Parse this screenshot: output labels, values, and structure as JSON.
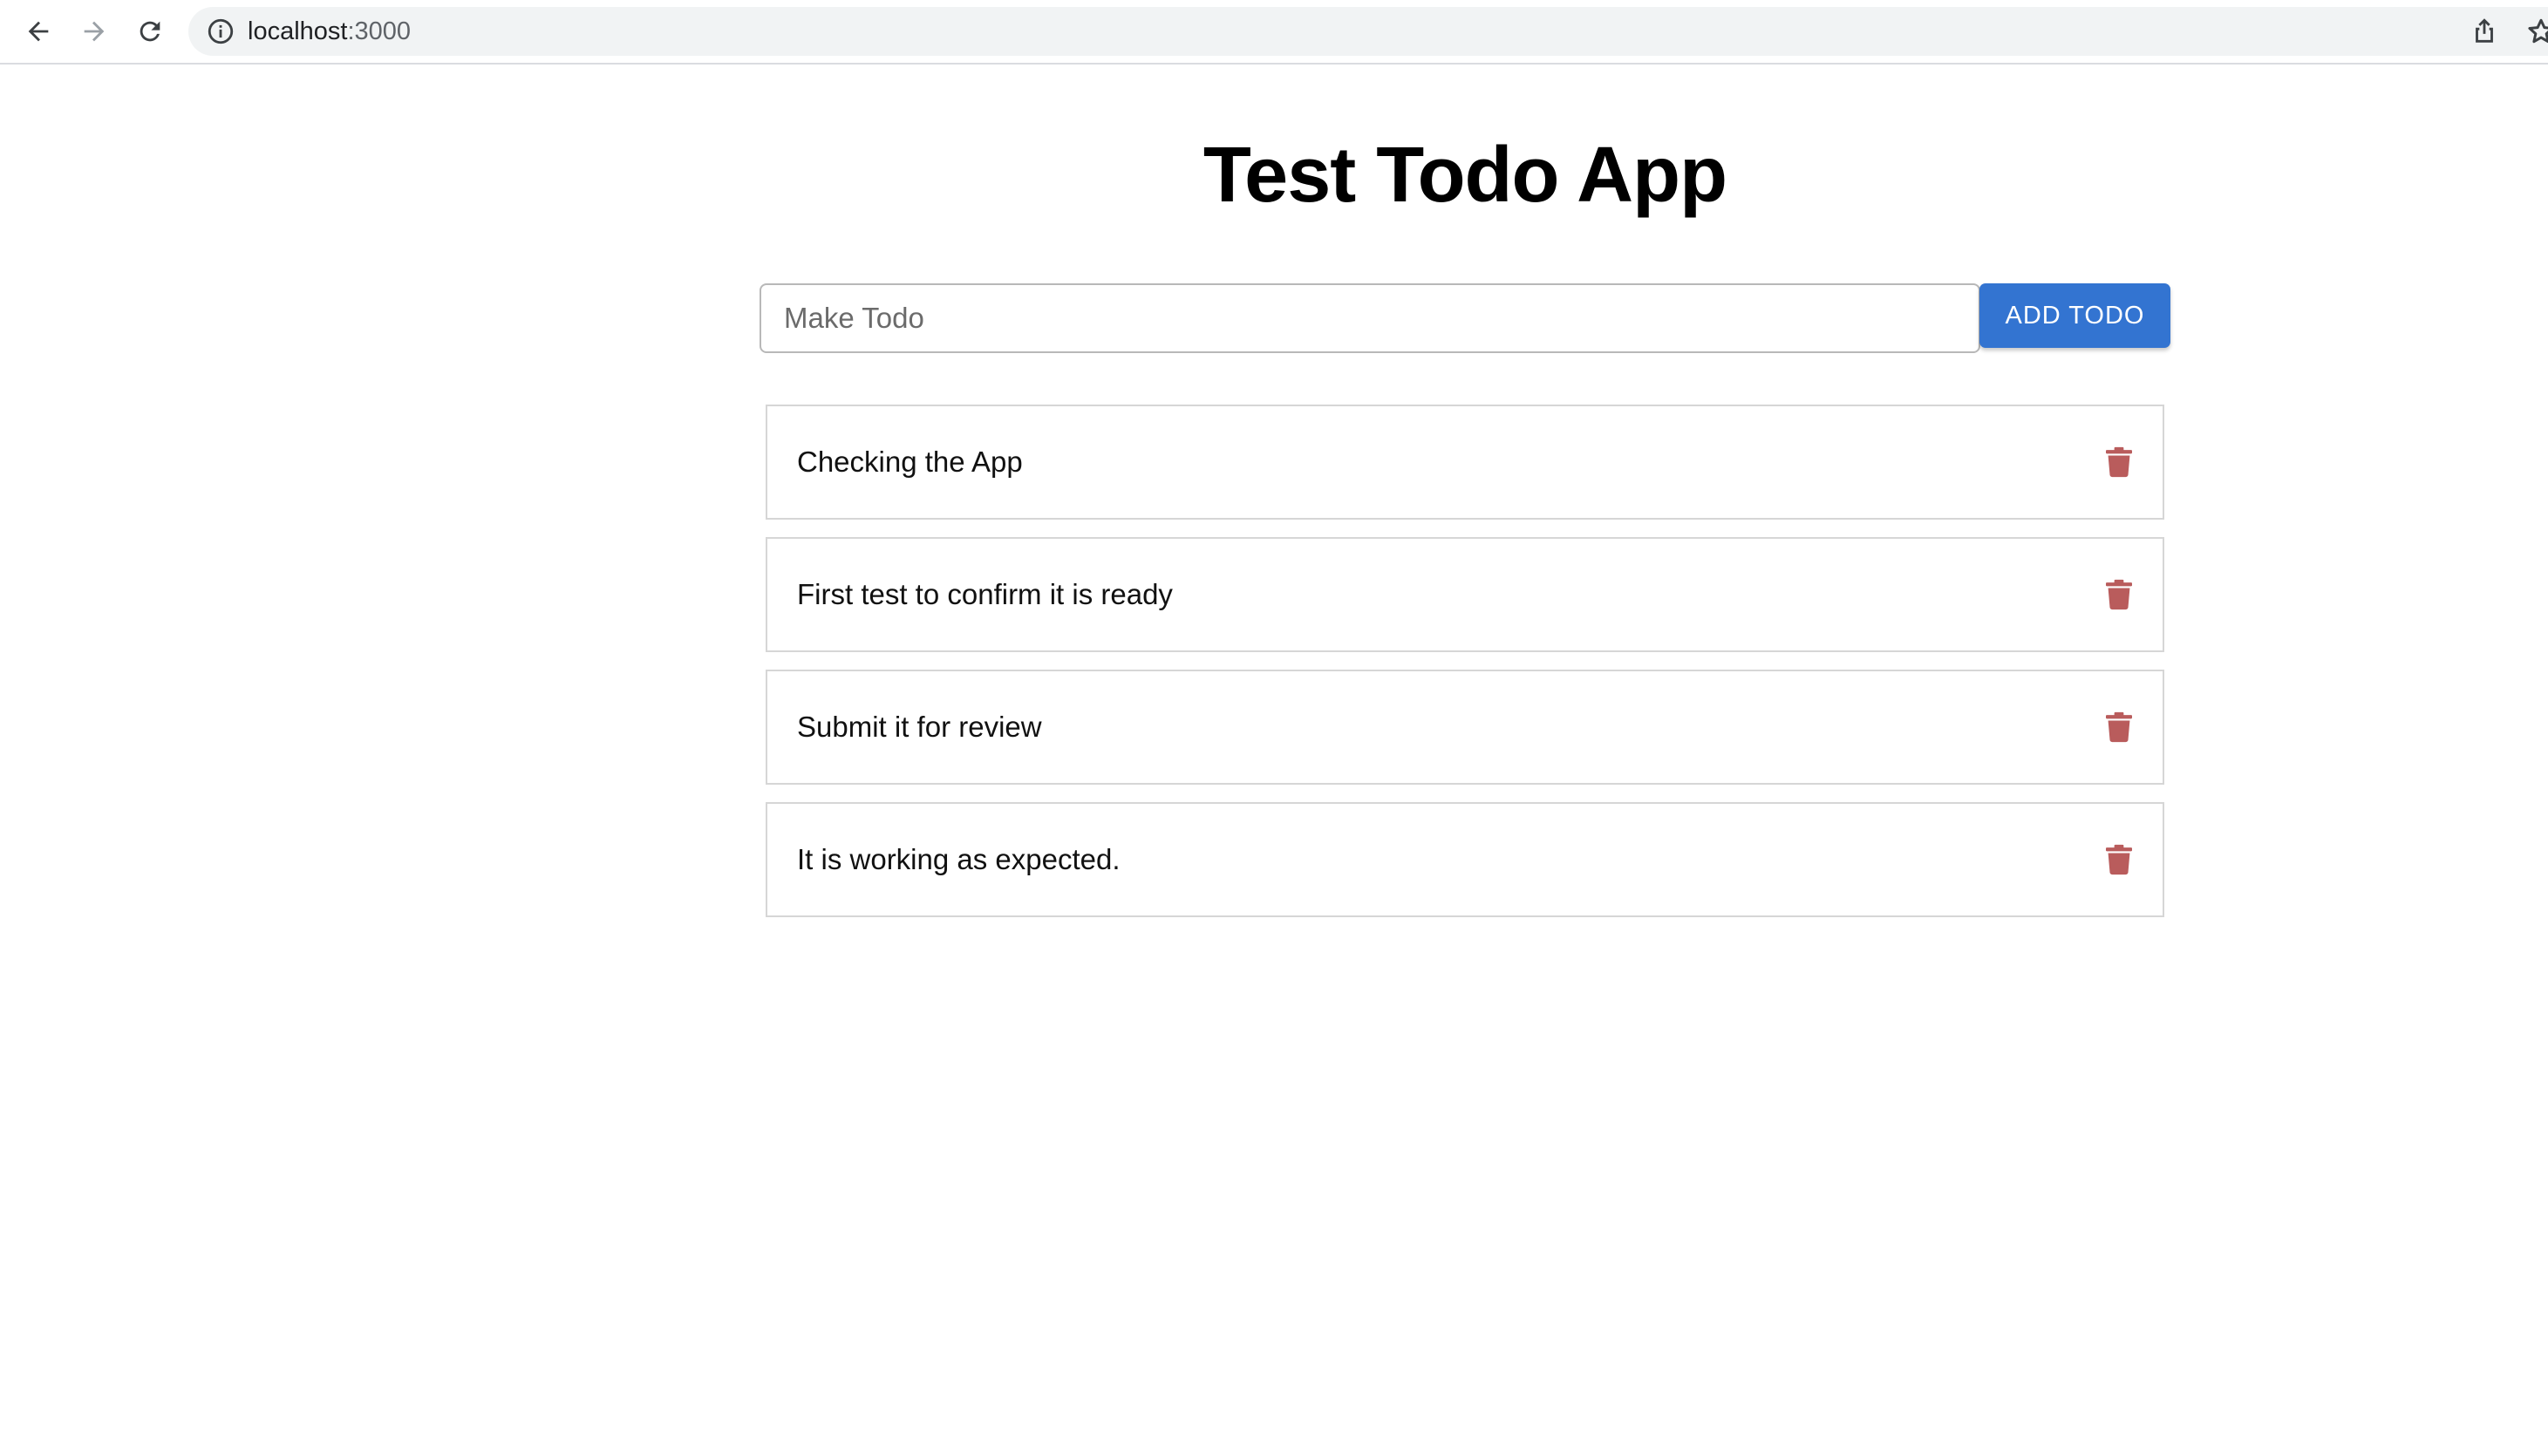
{
  "browser": {
    "url_host": "localhost",
    "url_port": ":3000"
  },
  "app": {
    "title": "Test Todo App",
    "input_placeholder": "Make Todo",
    "input_value": "",
    "add_button_label": "ADD TODO",
    "colors": {
      "accent": "#3374d1",
      "delete_icon": "#b95c5c"
    }
  },
  "todos": [
    {
      "text": "Checking the App"
    },
    {
      "text": "First test to confirm it is ready"
    },
    {
      "text": "Submit it for review"
    },
    {
      "text": "It is working as expected."
    }
  ]
}
